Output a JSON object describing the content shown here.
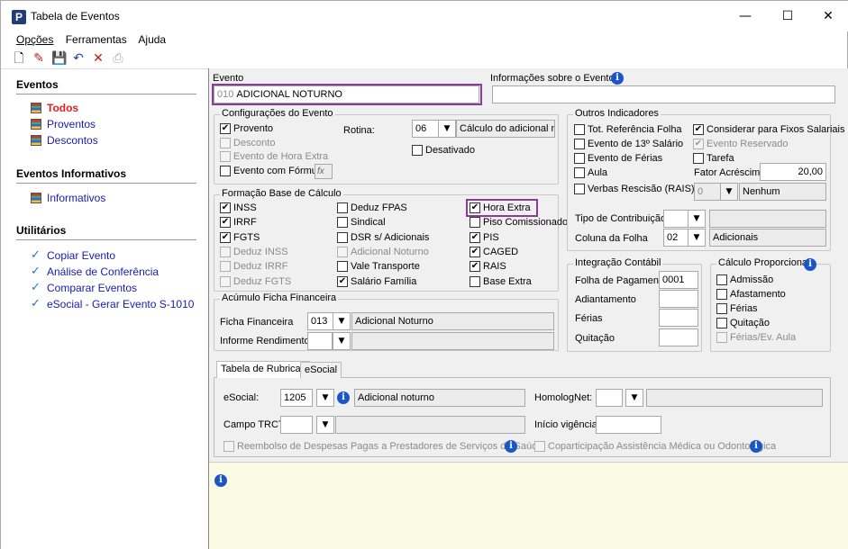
{
  "window": {
    "title": "Tabela de Eventos",
    "min": "—",
    "max": "☐",
    "close": "✕",
    "app_icon": "P"
  },
  "menu": [
    "Opções",
    "Ferramentas",
    "Ajuda"
  ],
  "sidebar": {
    "eventos_title": "Eventos",
    "eventos": [
      {
        "label": "Todos",
        "active": true
      },
      {
        "label": "Proventos"
      },
      {
        "label": "Descontos"
      }
    ],
    "informativos_title": "Eventos Informativos",
    "informativos": [
      {
        "label": "Informativos"
      }
    ],
    "utilitarios_title": "Utilitários",
    "utilitarios": [
      {
        "label": "Copiar Evento"
      },
      {
        "label": "Análise de Conferência"
      },
      {
        "label": "Comparar Eventos"
      },
      {
        "label": "eSocial - Gerar Evento S-1010"
      }
    ]
  },
  "evento": {
    "label": "Evento",
    "code": "010",
    "name": "ADICIONAL NOTURNO",
    "info_label": "Informações sobre o Evento",
    "info_value": ""
  },
  "config": {
    "title": "Configurações do Evento",
    "provento": "Provento",
    "desconto": "Desconto",
    "hora_extra": "Evento de Hora Extra",
    "formula": "Evento com Fórmula",
    "formula_btn": "fx",
    "rotina_label": "Rotina:",
    "rotina_code": "06",
    "rotina_desc": "Cálculo do adicional not..",
    "desativado": "Desativado"
  },
  "outros": {
    "title": "Outros Indicadores",
    "tot_ref": "Tot. Referência Folha",
    "evento13": "Evento de 13º Salário",
    "ferias": "Evento de Férias",
    "aula": "Aula",
    "verbas": "Verbas Rescisão (RAIS)",
    "considerar": "Considerar para Fixos Salariais",
    "reservado": "Evento Reservado",
    "tarefa": "Tarefa",
    "fator_label": "Fator Acréscimo",
    "fator_value": "20,00",
    "verbas_code": "0",
    "verbas_desc": "Nenhum",
    "tipo_label": "Tipo de Contribuição",
    "coluna_label": "Coluna da Folha",
    "coluna_code": "02",
    "coluna_desc": "Adicionais"
  },
  "base": {
    "title": "Formação Base de Cálculo",
    "col1": [
      {
        "l": "INSS",
        "c": true
      },
      {
        "l": "IRRF",
        "c": true
      },
      {
        "l": "FGTS",
        "c": true
      },
      {
        "l": "Deduz INSS",
        "d": true
      },
      {
        "l": "Deduz IRRF",
        "d": true
      },
      {
        "l": "Deduz FGTS",
        "d": true
      }
    ],
    "col2": [
      {
        "l": "Deduz FPAS"
      },
      {
        "l": "Sindical"
      },
      {
        "l": "DSR s/ Adicionais"
      },
      {
        "l": "Adicional Noturno",
        "d": true
      },
      {
        "l": "Vale Transporte"
      },
      {
        "l": "Salário Família",
        "c": true
      }
    ],
    "col3": [
      {
        "l": "Hora Extra",
        "c": true
      },
      {
        "l": "Piso Comissionado"
      },
      {
        "l": "PIS",
        "c": true
      },
      {
        "l": "CAGED",
        "c": true
      },
      {
        "l": "RAIS",
        "c": true
      },
      {
        "l": "Base Extra"
      }
    ]
  },
  "acumulo": {
    "title": "Acúmulo Ficha Financeira",
    "ficha_label": "Ficha Financeira",
    "ficha_code": "013",
    "ficha_desc": "Adicional Noturno",
    "informe_label": "Informe Rendimentos"
  },
  "integracao": {
    "title": "Integração Contábil",
    "folha_label": "Folha de Pagamento",
    "folha_value": "0001",
    "adiant_label": "Adiantamento",
    "ferias_label": "Férias",
    "quitacao_label": "Quitação"
  },
  "proporcional": {
    "title": "Cálculo Proporcional",
    "admissao": "Admissão",
    "afastamento": "Afastamento",
    "ferias": "Férias",
    "quitacao": "Quitação",
    "ferias_ev": "Férias/Ev. Aula"
  },
  "tabs": [
    "Tabela de Rubricas",
    "eSocial"
  ],
  "esocial": {
    "label": "eSocial:",
    "code": "1205",
    "desc": "Adicional noturno",
    "homolog_label": "HomologNet:",
    "trct_label": "Campo TRCT:",
    "inicio_label": "Início vigência:",
    "reembolso": "Reembolso de Despesas Pagas a Prestadores de Serviços de Saúde",
    "coparticipacao": "Coparticipação Assistência Médica ou Odontológica"
  },
  "colors": {
    "highlight": "#8b3c9b",
    "link": "#1a1ab4",
    "active": "#e02020",
    "info": "#1b56c8",
    "note_bg": "#fbfbe3"
  }
}
